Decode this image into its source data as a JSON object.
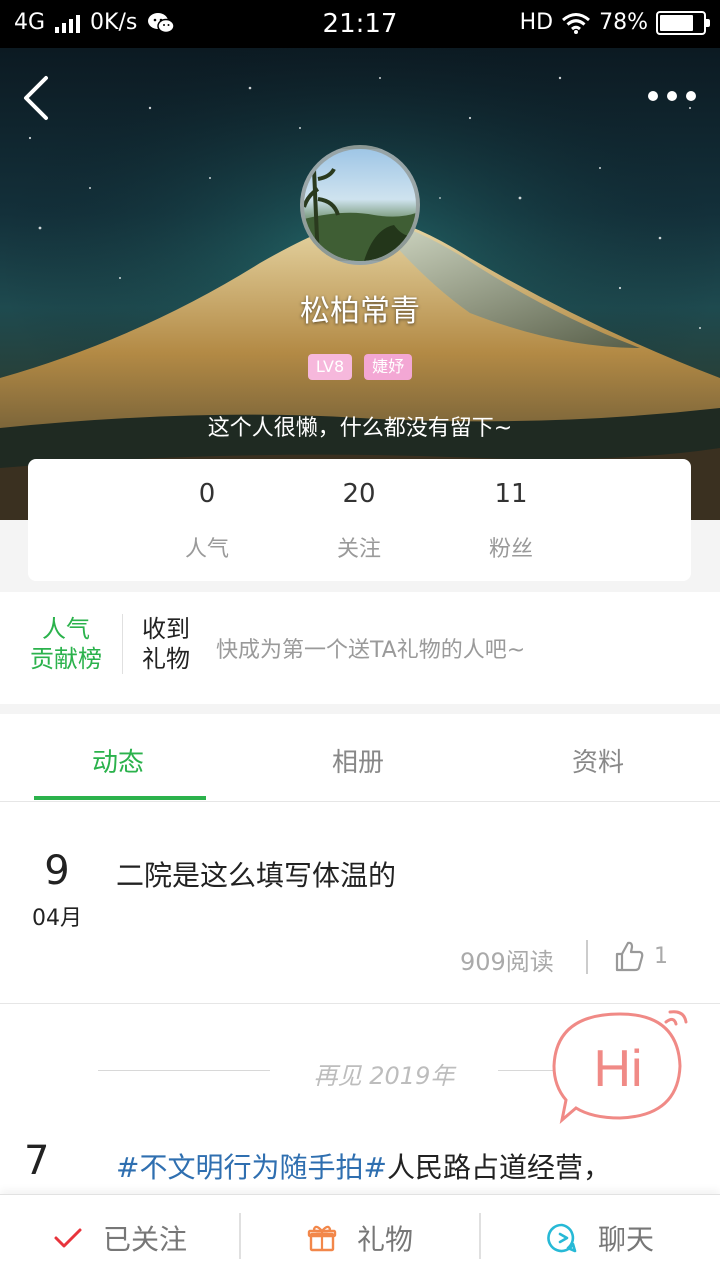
{
  "status_bar": {
    "network": "4G",
    "speed": "0K/s",
    "time": "21:17",
    "hd": "HD",
    "battery": "78%",
    "battery_level": 0.78
  },
  "profile": {
    "name": "松柏常青",
    "badges": [
      "LV8",
      "婕妤"
    ],
    "bio": "这个人很懒，什么都没有留下~",
    "stats": [
      {
        "value": "0",
        "label": "人气"
      },
      {
        "value": "20",
        "label": "关注"
      },
      {
        "value": "11",
        "label": "粉丝"
      }
    ]
  },
  "gifts": {
    "rank_label_line1": "人气",
    "rank_label_line2": "贡献榜",
    "received_line1": "收到",
    "received_line2": "礼物",
    "hint": "快成为第一个送TA礼物的人吧~"
  },
  "tabs": [
    {
      "label": "动态",
      "active": true
    },
    {
      "label": "相册",
      "active": false
    },
    {
      "label": "资料",
      "active": false
    }
  ],
  "feed": {
    "post1": {
      "day": "9",
      "month": "04月",
      "title": "二院是这么填写体温的",
      "reads": "909阅读",
      "likes": "1"
    },
    "year_separator": "再见 2019年",
    "post2": {
      "day": "7",
      "tag": "#不文明行为随手拍#",
      "title_rest": "人民路占道经营，"
    }
  },
  "hi_bubble": "Hi",
  "bottom_bar": {
    "follow_label": "已关注",
    "gift_label": "礼物",
    "chat_label": "聊天"
  },
  "colors": {
    "accent_green": "#2bb24c",
    "badge_pink": "#f3a7d4",
    "hi_coral": "#f08a86",
    "follow_red": "#e8343c",
    "gift_orange": "#f2874a",
    "chat_cyan": "#27b9d6",
    "tag_blue": "#2f6fb0"
  },
  "icons": [
    "back-arrow-icon",
    "more-dots-icon",
    "wifi-icon",
    "wechat-icon",
    "thumbs-up-icon",
    "check-icon",
    "gift-icon",
    "chat-bubble-icon"
  ]
}
